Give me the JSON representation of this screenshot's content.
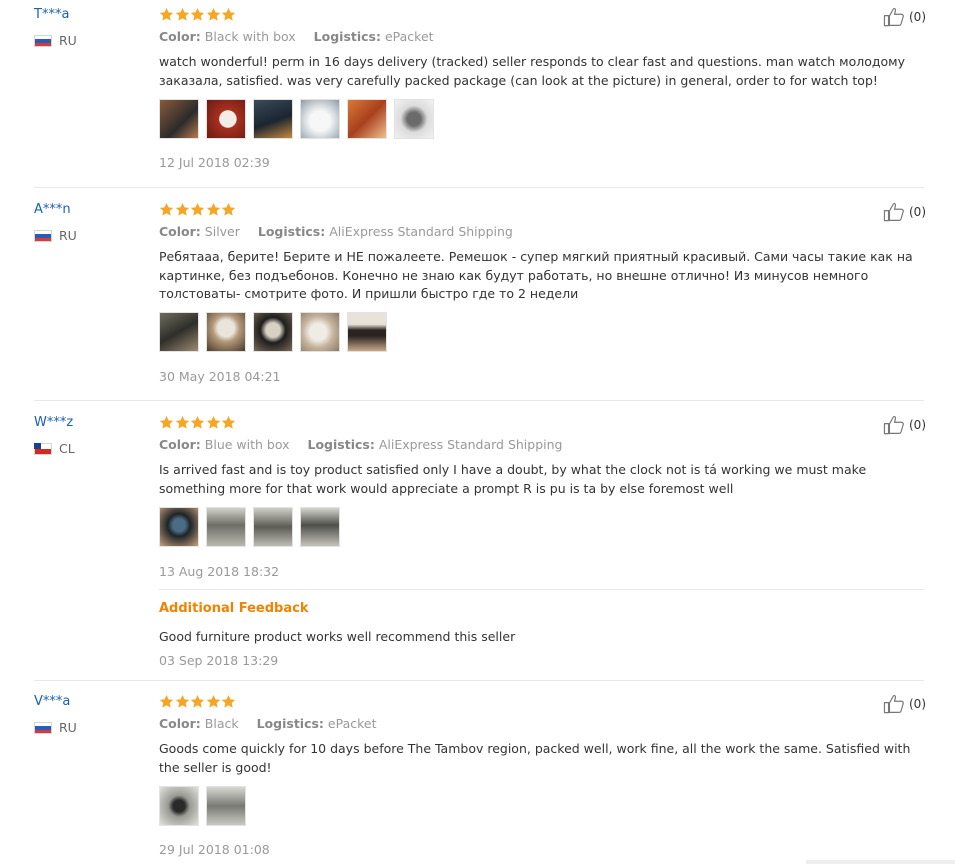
{
  "colors": {
    "username": "#1a5fb4",
    "star": "#f5a623",
    "additional_feedback": "#f08300",
    "muted": "#999999"
  },
  "labels": {
    "color": "Color:",
    "logistics": "Logistics:"
  },
  "reviews": [
    {
      "user": "T***a",
      "country": "RU",
      "flag": "ru",
      "rating": 5,
      "color": "Black with box",
      "logistics": "ePacket",
      "text": "watch wonderful! perm in 16 days delivery (tracked) seller responds to clear fast and questions. man watch молодому заказала, satisfied. was very carefully packed package (can look at the picture) in general, order to for watch top!",
      "photos": 6,
      "date": "12 Jul 2018 02:39",
      "likes": "(0)"
    },
    {
      "user": "A***n",
      "country": "RU",
      "flag": "ru",
      "rating": 5,
      "color": "Silver",
      "logistics": "AliExpress Standard Shipping",
      "text": "Ребятааа, берите! Берите и НЕ пожалеете. Ремешок - супер мягкий приятный красивый. Сами часы такие как на картинке, без подъебонов. Конечно не знаю как будут работать, но внешне отлично! Из минусов немного толстоваты- смотрите фото. И пришли быстро где то 2 недели",
      "photos": 5,
      "date": "30 May 2018 04:21",
      "likes": "(0)"
    },
    {
      "user": "W***z",
      "country": "CL",
      "flag": "cl",
      "rating": 5,
      "color": "Blue with box",
      "logistics": "AliExpress Standard Shipping",
      "text": "Is arrived fast and is toy product satisfied only I have a doubt, by what the clock not is tá working we must make something more for that work would appreciate a prompt R is pu is ta by else foremost well",
      "photos": 4,
      "date": "13 Aug 2018 18:32",
      "likes": "(0)",
      "additional": {
        "title": "Additional Feedback",
        "text": "Good furniture product works well recommend this seller",
        "date": "03 Sep 2018 13:29"
      }
    },
    {
      "user": "V***a",
      "country": "RU",
      "flag": "ru",
      "rating": 5,
      "color": "Black",
      "logistics": "ePacket",
      "text": "Goods come quickly for 10 days before The Tambov region, packed well, work fine, all the work the same. Satisfied with the seller is good!",
      "photos": 2,
      "date": "29 Jul 2018 01:08",
      "likes": "(0)"
    }
  ]
}
